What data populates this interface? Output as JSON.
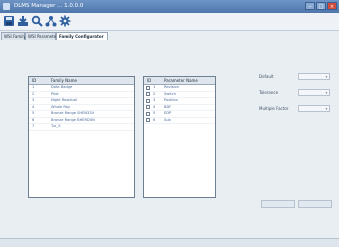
{
  "window": {
    "title": "DLMS Manager ... 1.0.0.0"
  },
  "toolbar": {
    "icons": [
      "save-icon",
      "download-icon",
      "search-icon",
      "network-icon",
      "settings-icon"
    ]
  },
  "tabs": [
    {
      "label": "WSI Family"
    },
    {
      "label": "WSI Parameter"
    },
    {
      "label": "Family Configurator"
    }
  ],
  "family_grid": {
    "headers": [
      "ID",
      "Family Name"
    ],
    "rows": [
      {
        "id": "1",
        "name": "Data Badge"
      },
      {
        "id": "2",
        "name": "Pilot"
      },
      {
        "id": "3",
        "name": "Night Residual"
      },
      {
        "id": "4",
        "name": "Whale Ray"
      },
      {
        "id": "5",
        "name": "Bronze Range SHEN334"
      },
      {
        "id": "6",
        "name": "Bronze Range BHERD0N"
      },
      {
        "id": "7",
        "name": "Tur_S"
      }
    ]
  },
  "parameter_grid": {
    "headers": [
      "ID",
      "Parameter Name"
    ],
    "rows": [
      {
        "id": "1",
        "name": "Revision"
      },
      {
        "id": "2",
        "name": "Switch"
      },
      {
        "id": "3",
        "name": "Position"
      },
      {
        "id": "4",
        "name": "BDF"
      },
      {
        "id": "5",
        "name": "EDP"
      },
      {
        "id": "6",
        "name": "Sub"
      }
    ]
  },
  "fields": [
    {
      "label": "Default"
    },
    {
      "label": "Tolerance"
    },
    {
      "label": "Multiple Factor"
    }
  ],
  "buttons": {
    "left": "",
    "right": ""
  }
}
